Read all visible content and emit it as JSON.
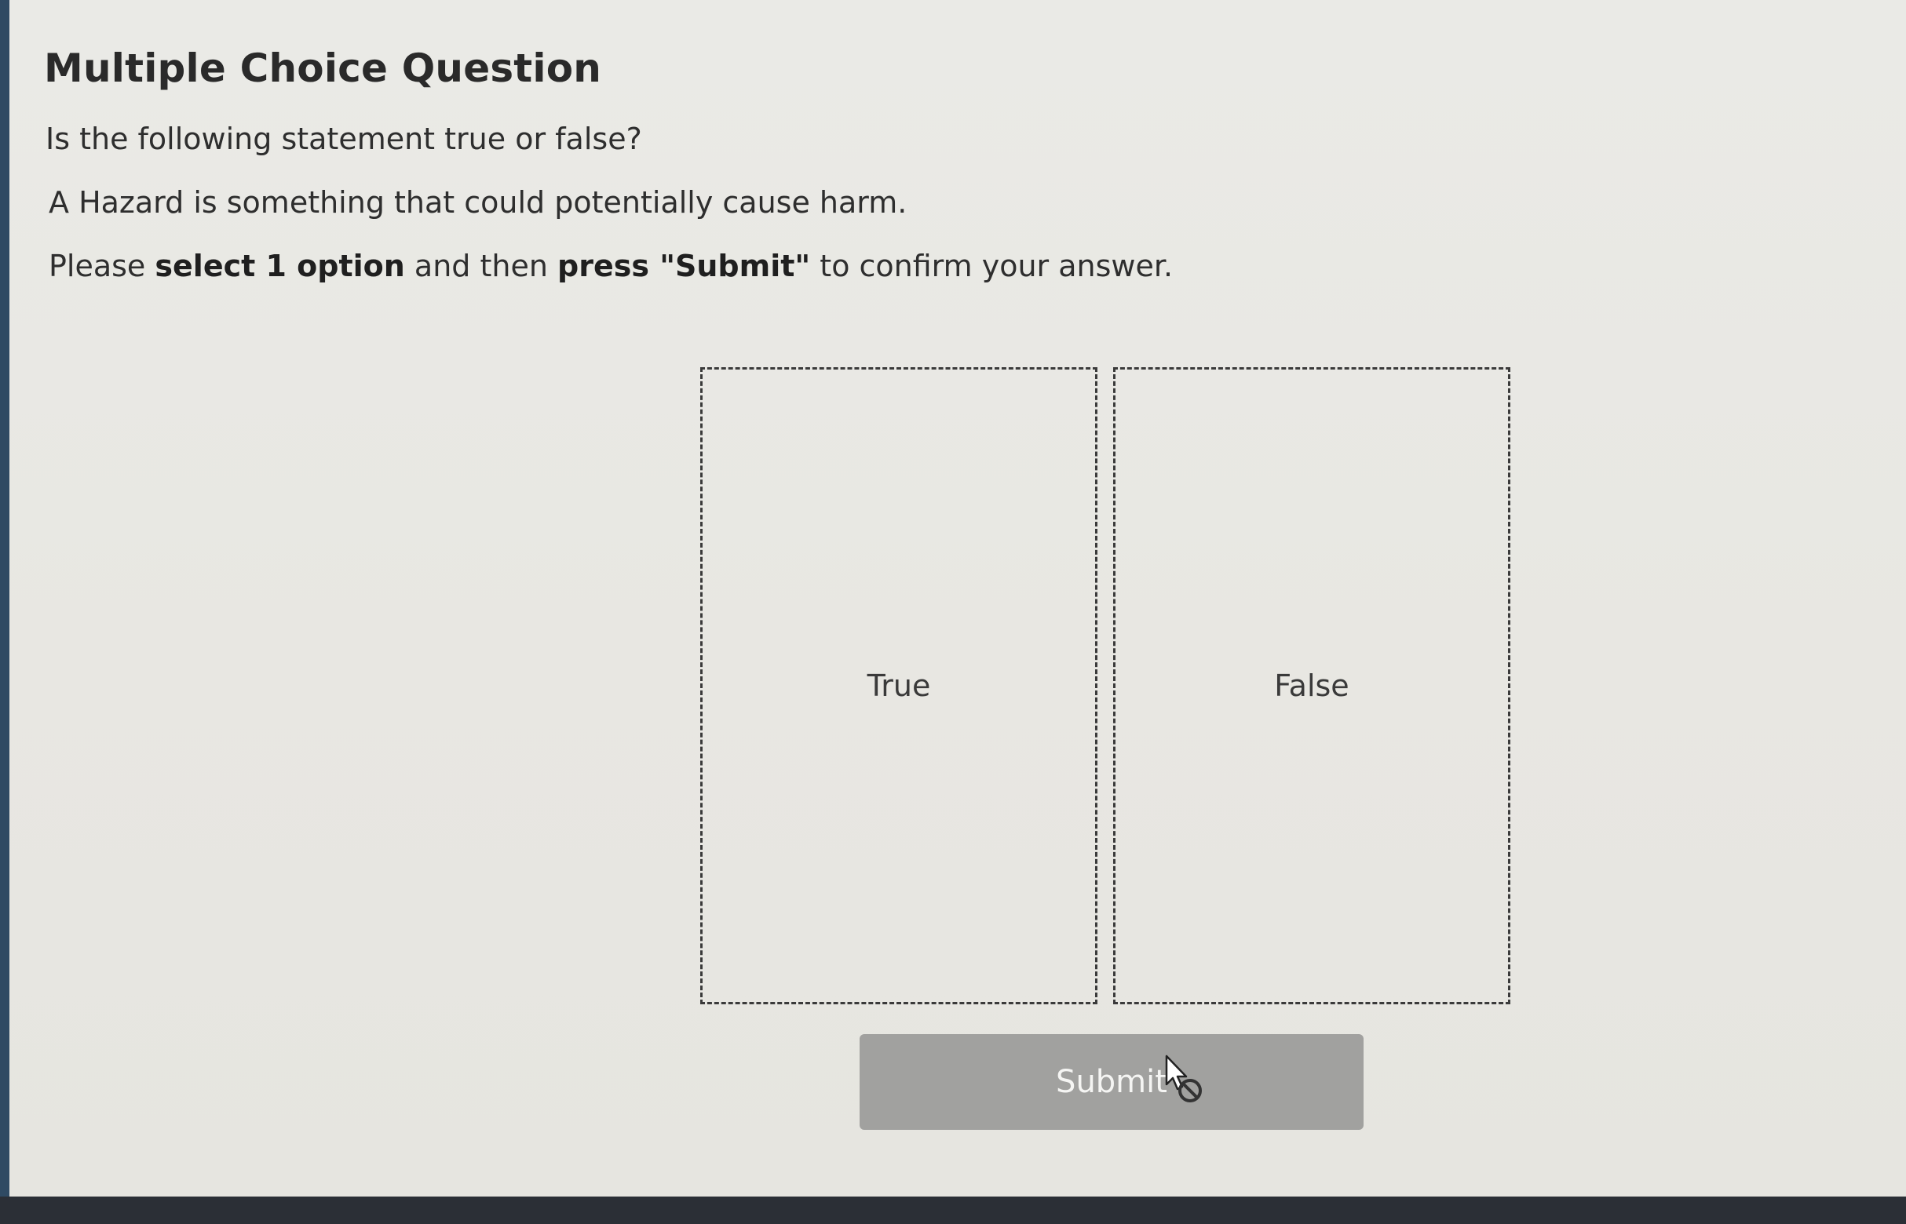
{
  "question": {
    "title": "Multiple Choice Question",
    "prompt": "Is the following statement true or false?",
    "statement": "A Hazard is something that could potentially cause harm.",
    "instruction": {
      "part1": "Please ",
      "bold1": "select 1 option",
      "part2": " and then ",
      "bold2": "press \"Submit\"",
      "part3": " to confirm your answer."
    }
  },
  "options": [
    {
      "label": "True"
    },
    {
      "label": "False"
    }
  ],
  "submit": {
    "label": "Submit",
    "state": "disabled"
  },
  "cursor": {
    "icon": "not-allowed-cursor-icon"
  }
}
